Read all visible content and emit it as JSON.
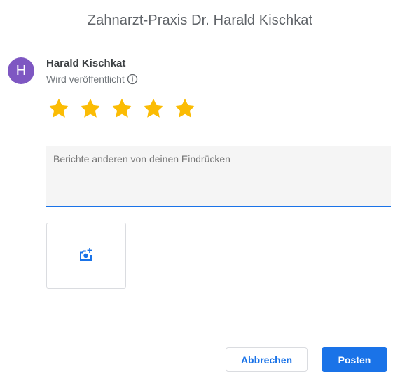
{
  "header": {
    "title": "Zahnarzt-Praxis Dr. Harald Kischkat"
  },
  "user": {
    "avatar_initial": "H",
    "avatar_color": "#7e57c2",
    "name": "Harald Kischkat",
    "visibility_label": "Wird veröffentlicht",
    "visibility_icon": "info-icon"
  },
  "rating": {
    "value": 5,
    "max": 5,
    "star_color": "#fbbc04",
    "star_icon": "star-icon"
  },
  "review": {
    "placeholder": "Berichte anderen von deinen Eindrücken",
    "value": ""
  },
  "photo": {
    "icon": "add-photo-icon",
    "icon_color": "#1a73e8"
  },
  "actions": {
    "cancel_label": "Abbrechen",
    "post_label": "Posten",
    "accent": "#1a73e8"
  }
}
